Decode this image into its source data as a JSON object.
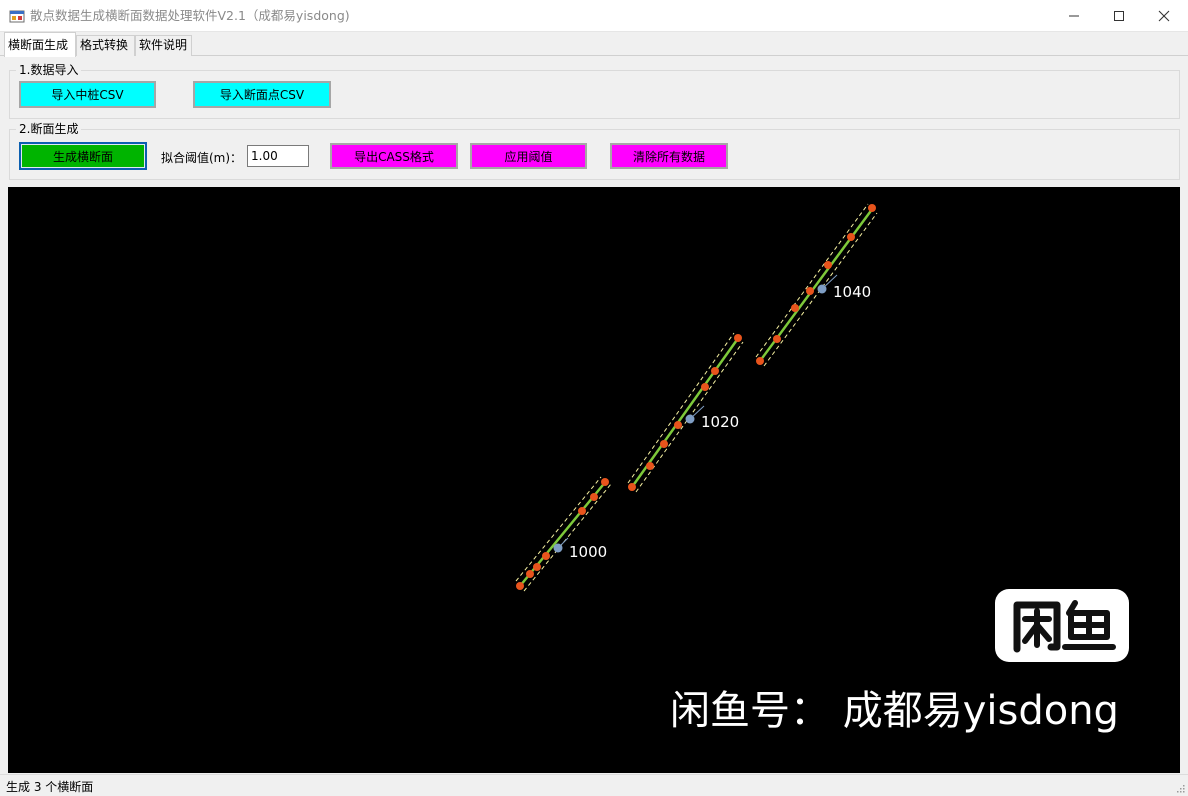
{
  "window": {
    "title": "散点数据生成横断面数据处理软件V2.1（成都易yisdong)",
    "controls": [
      "minimize",
      "maximize",
      "close"
    ]
  },
  "tabs": [
    {
      "label": "横断面生成",
      "active": true
    },
    {
      "label": "格式转换",
      "active": false
    },
    {
      "label": "软件说明",
      "active": false
    }
  ],
  "import_group": {
    "label": "1.数据导入",
    "buttons": {
      "import_centerline": "导入中桩CSV",
      "import_section_points": "导入断面点CSV"
    }
  },
  "generate_group": {
    "label": "2.断面生成",
    "generate_button": "生成横断面",
    "threshold_label": "拟合阈值(m)：",
    "threshold_value": "1.00",
    "export_button": "导出CASS格式",
    "apply_button": "应用阈值",
    "clear_button": "清除所有数据"
  },
  "colors": {
    "cyan_button": "#00ffff",
    "magenta_button": "#ff00ff",
    "green_button": "#00b400",
    "canvas_bg": "#000000",
    "section_line": "#7ec93a",
    "fit_dash": "#f5f0a0",
    "point": "#e8541c",
    "center_point": "#7f9ec4"
  },
  "canvas": {
    "sections": [
      {
        "label": "1000",
        "points": 9
      },
      {
        "label": "1020",
        "points": 9
      },
      {
        "label": "1040",
        "points": 9
      }
    ]
  },
  "watermark": {
    "logo_text": "闲鱼",
    "text": "闲鱼号： 成都易yisdong"
  },
  "status": {
    "text": "生成 3 个横断面"
  }
}
